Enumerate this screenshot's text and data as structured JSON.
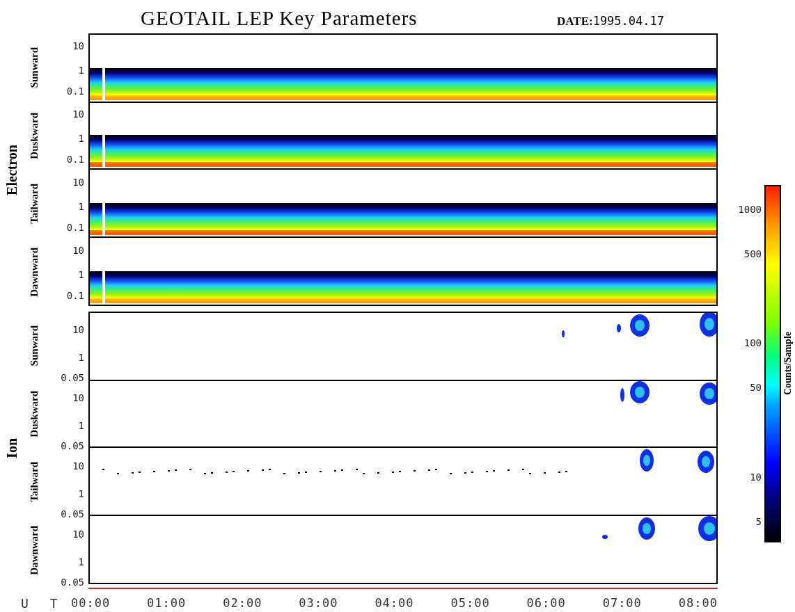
{
  "title": "GEOTAIL LEP Key Parameters",
  "date_label": "DATE:",
  "date": "1995.04.17",
  "groups": [
    {
      "name": "Electron",
      "kind": "electron",
      "panels": [
        {
          "label": "Sunward",
          "yticks": [
            "10",
            "1",
            "0.1"
          ]
        },
        {
          "label": "Duskward",
          "yticks": [
            "10",
            "1",
            "0.1"
          ]
        },
        {
          "label": "Tailward",
          "yticks": [
            "10",
            "1",
            "0.1"
          ]
        },
        {
          "label": "Dawnward",
          "yticks": [
            "10",
            "1",
            "0.1"
          ]
        }
      ]
    },
    {
      "name": "Ion",
      "kind": "ion",
      "panels": [
        {
          "label": "Sunward",
          "yticks": [
            "10",
            "1",
            "0.05"
          ]
        },
        {
          "label": "Duskward",
          "yticks": [
            "10",
            "1",
            "0.05"
          ]
        },
        {
          "label": "Tailward",
          "yticks": [
            "10",
            "1",
            "0.05"
          ]
        },
        {
          "label": "Dawnward",
          "yticks": [
            "10",
            "1",
            "0.05"
          ]
        }
      ]
    }
  ],
  "x_axis": {
    "label": "U T",
    "ticks": [
      "00:00",
      "01:00",
      "02:00",
      "03:00",
      "04:00",
      "05:00",
      "06:00",
      "07:00",
      "08:00"
    ]
  },
  "colorbar": {
    "label": "Counts/Sample",
    "ticks": [
      "1000",
      "500",
      "100",
      "50",
      "10",
      "5"
    ]
  }
}
